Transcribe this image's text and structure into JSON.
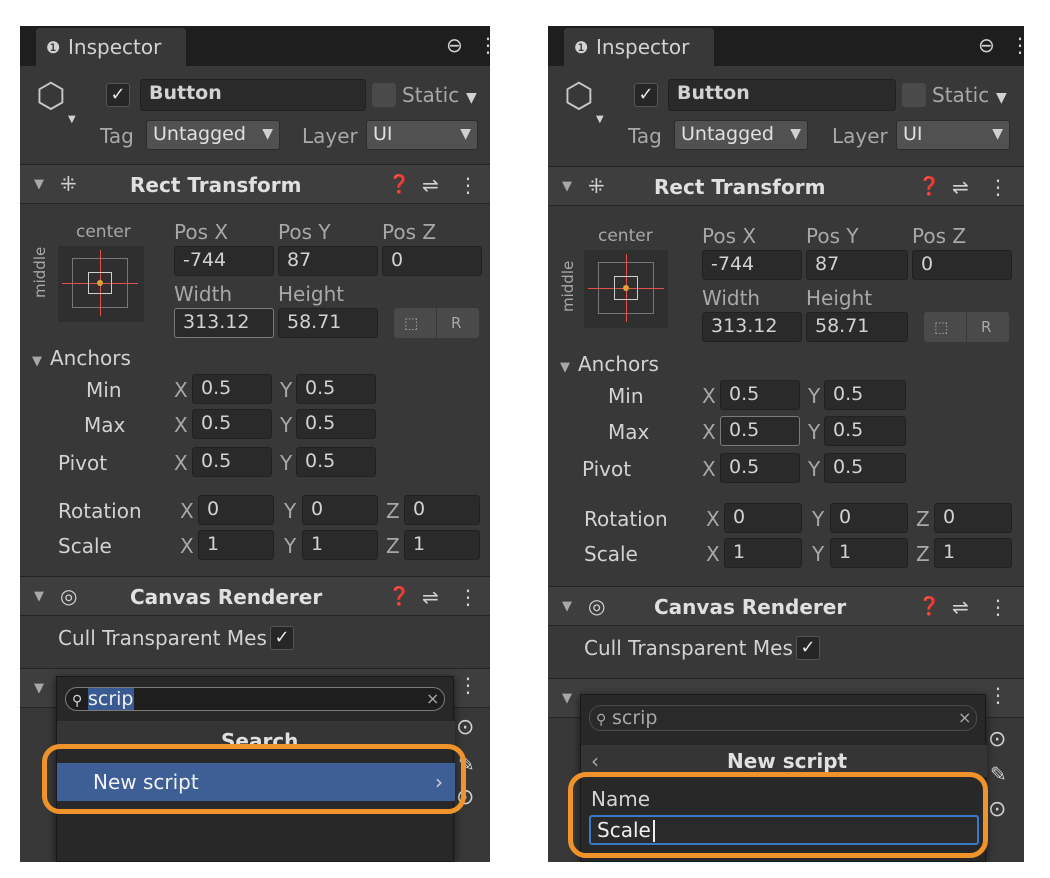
{
  "accent_orange": "#f0932b",
  "accent_blue": "#3e5f96",
  "inspector": {
    "tab_title": "Inspector",
    "object_name": "Button",
    "static_label": "Static",
    "tag_label": "Tag",
    "tag_value": "Untagged",
    "layer_label": "Layer",
    "layer_value": "UI"
  },
  "rect_transform": {
    "title": "Rect Transform",
    "anchor_preset_top": "center",
    "anchor_preset_side": "middle",
    "pos_x_label": "Pos X",
    "pos_y_label": "Pos Y",
    "pos_z_label": "Pos Z",
    "pos_x": "-744",
    "pos_y": "87",
    "pos_z": "0",
    "width_label": "Width",
    "height_label": "Height",
    "width": "313.12",
    "height": "58.71",
    "r_button": "R",
    "anchors_label": "Anchors",
    "min_label": "Min",
    "max_label": "Max",
    "pivot_label": "Pivot",
    "x": "X",
    "y": "Y",
    "z": "Z",
    "min_x": "0.5",
    "min_y": "0.5",
    "max_x": "0.5",
    "max_y": "0.5",
    "pivot_x": "0.5",
    "pivot_y": "0.5",
    "rotation_label": "Rotation",
    "scale_label": "Scale",
    "rot_x": "0",
    "rot_y": "0",
    "rot_z": "0",
    "scale_x": "1",
    "scale_y": "1",
    "scale_z": "1"
  },
  "canvas_renderer": {
    "title": "Canvas Renderer",
    "cull_label": "Cull Transparent Mes"
  },
  "left_popup": {
    "search_value": "scrip",
    "section_title": "Search",
    "item_label": "New script"
  },
  "right_popup": {
    "search_value": "scrip",
    "section_title": "New script",
    "name_label": "Name",
    "name_value": "Scale"
  }
}
